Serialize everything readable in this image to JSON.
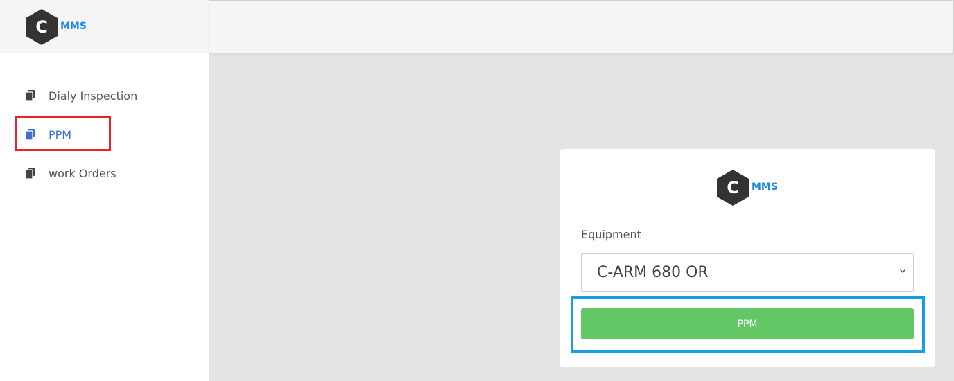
{
  "brand": {
    "icon_letter": "C",
    "name": "MMS"
  },
  "sidebar": {
    "items": [
      {
        "label": "Dialy Inspection",
        "icon": "document-copy-icon"
      },
      {
        "label": "PPM",
        "icon": "document-copy-icon",
        "active": true
      },
      {
        "label": "work Orders",
        "icon": "document-copy-icon"
      }
    ]
  },
  "form": {
    "logo": {
      "icon_letter": "C",
      "name": "MMS"
    },
    "equipment_label": "Equipment",
    "equipment_selected": "C-ARM 680 OR",
    "submit_label": "PPM"
  },
  "colors": {
    "accent": "#3d6fd1",
    "brand_blue": "#1e88e5",
    "button_green": "#63c766",
    "highlight_red": "#e1262d",
    "highlight_blue": "#1a9ce0"
  }
}
